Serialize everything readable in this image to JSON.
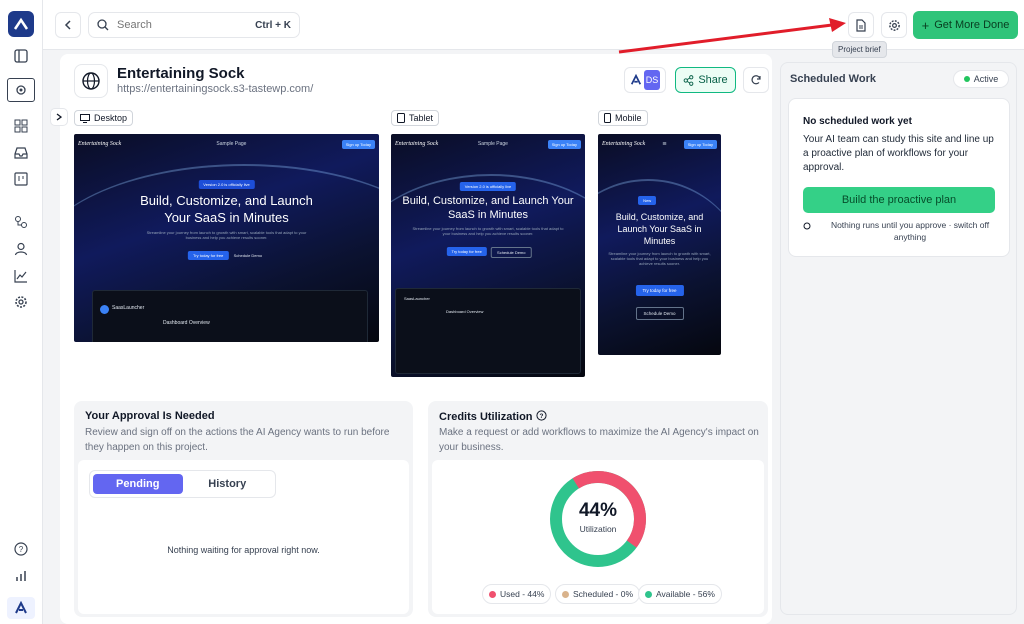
{
  "search": {
    "placeholder": "Search",
    "shortcut": "Ctrl + K"
  },
  "topbar": {
    "cta_label": "Get More Done",
    "tooltip": "Project brief"
  },
  "project": {
    "name": "Entertaining Sock",
    "url": "https://entertainingsock.s3-tastewp.com/",
    "avatar_initials": "DS",
    "share_label": "Share"
  },
  "previews": {
    "desktop_label": "Desktop",
    "tablet_label": "Tablet",
    "mobile_label": "Mobile",
    "site_brand": "Entertaining Sock",
    "nav_link": "Sample Page",
    "nav_cta": "Sign up Today",
    "headline": "Build, Customize, and Launch Your SaaS in Minutes",
    "tag": "Version 2.0 is officially live",
    "tag_short": "New",
    "sub": "Streamline your journey from launch to growth with smart, scalable tools that adapt to your business and help you achieve results sooner.",
    "btn_primary": "Try today for free",
    "btn_secondary": "Schedule Demo",
    "dash_brand": "SaasLauncher",
    "dash_title": "Dashboard Overview"
  },
  "approval": {
    "title": "Your Approval Is Needed",
    "desc": "Review and sign off on the actions the AI Agency wants to run before they happen on this project.",
    "tabs": [
      "Pending",
      "History"
    ],
    "empty": "Nothing waiting for approval right now."
  },
  "credits": {
    "title": "Credits Utilization",
    "desc": "Make a request or add workflows to maximize the AI Agency's impact on your business.",
    "percent_label": "44%",
    "center_caption": "Utilization",
    "legend": [
      "Used - 44%",
      "Scheduled - 0%",
      "Available - 56%"
    ],
    "used": 44,
    "scheduled": 0,
    "available": 56,
    "colors": {
      "used": "#f0506e",
      "scheduled": "#d9b38c",
      "available": "#2fc48d"
    }
  },
  "scheduled": {
    "title": "Scheduled Work",
    "status": "Active",
    "empty_title": "No scheduled work yet",
    "empty_desc": "Your AI team can study this site and line up a proactive plan of workflows for your approval.",
    "cta": "Build the proactive plan",
    "note": "Nothing runs until you approve · switch off anything"
  },
  "colors": {
    "accent": "#6366f1",
    "green": "#2fc47a",
    "brand_dark": "#1e3a8a"
  }
}
